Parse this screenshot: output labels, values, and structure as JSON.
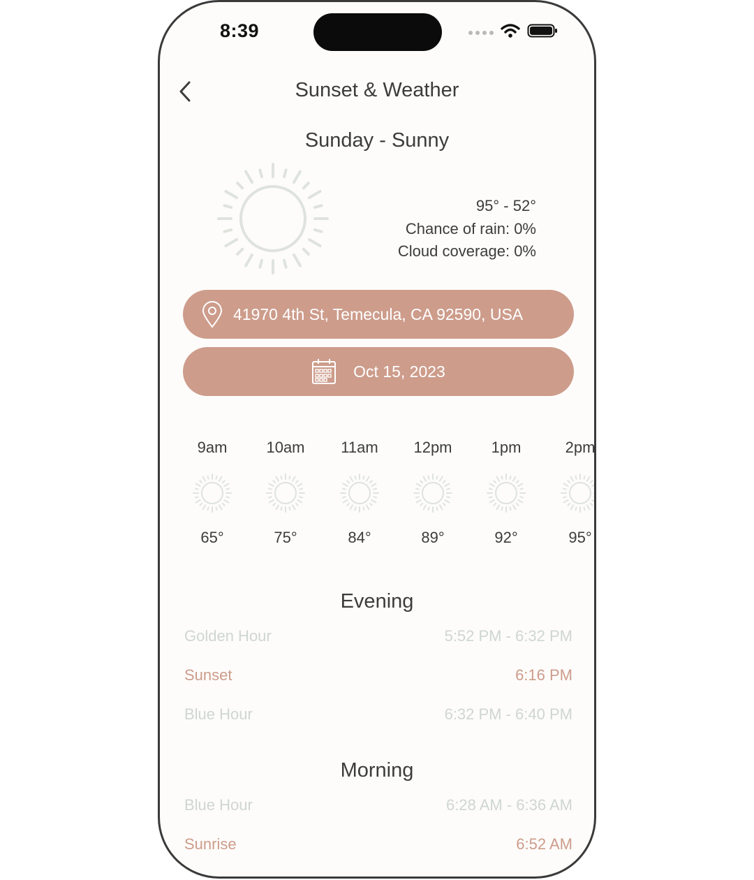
{
  "status": {
    "time": "8:39"
  },
  "header": {
    "title": "Sunset & Weather"
  },
  "weather": {
    "day_summary": "Sunday - Sunny",
    "temp_range": "95° - 52°",
    "rain": "Chance of rain: 0%",
    "cloud": "Cloud coverage: 0%",
    "icon": "sun-icon"
  },
  "location": {
    "address": "41970 4th St, Temecula, CA 92590, USA",
    "icon": "map-pin-icon"
  },
  "date": {
    "value": "Oct 15, 2023",
    "icon": "calendar-icon"
  },
  "hourly": [
    {
      "time": "9am",
      "temp": "65°"
    },
    {
      "time": "10am",
      "temp": "75°"
    },
    {
      "time": "11am",
      "temp": "84°"
    },
    {
      "time": "12pm",
      "temp": "89°"
    },
    {
      "time": "1pm",
      "temp": "92°"
    },
    {
      "time": "2pm",
      "temp": "95°"
    }
  ],
  "evening": {
    "title": "Evening",
    "rows": [
      {
        "label": "Golden Hour",
        "value": "5:52 PM - 6:32 PM"
      },
      {
        "label": "Sunset",
        "value": "6:16 PM"
      },
      {
        "label": "Blue Hour",
        "value": "6:32 PM - 6:40 PM"
      }
    ]
  },
  "morning": {
    "title": "Morning",
    "rows": [
      {
        "label": "Blue Hour",
        "value": "6:28 AM - 6:36 AM"
      },
      {
        "label": "Sunrise",
        "value": "6:52 AM"
      }
    ]
  },
  "colors": {
    "accent": "#cd9c8b",
    "muted": "#cfd6d1",
    "text": "#3c3c3c",
    "background": "#fdfcfa"
  }
}
